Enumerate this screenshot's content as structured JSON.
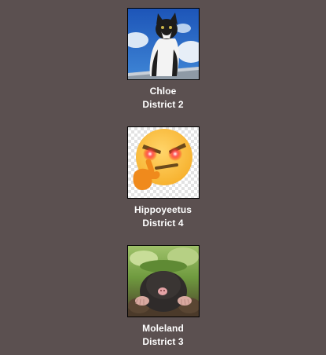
{
  "tributes": [
    {
      "name": "Chloe",
      "district": "District 2",
      "avatar_icon": "cat-photo"
    },
    {
      "name": "Hippoyeetus",
      "district": "District 4",
      "avatar_icon": "thinking-emoji-photo"
    },
    {
      "name": "Moleland",
      "district": "District 3",
      "avatar_icon": "mole-photo"
    }
  ],
  "colors": {
    "background": "#5b5050",
    "text": "#ffffff"
  }
}
